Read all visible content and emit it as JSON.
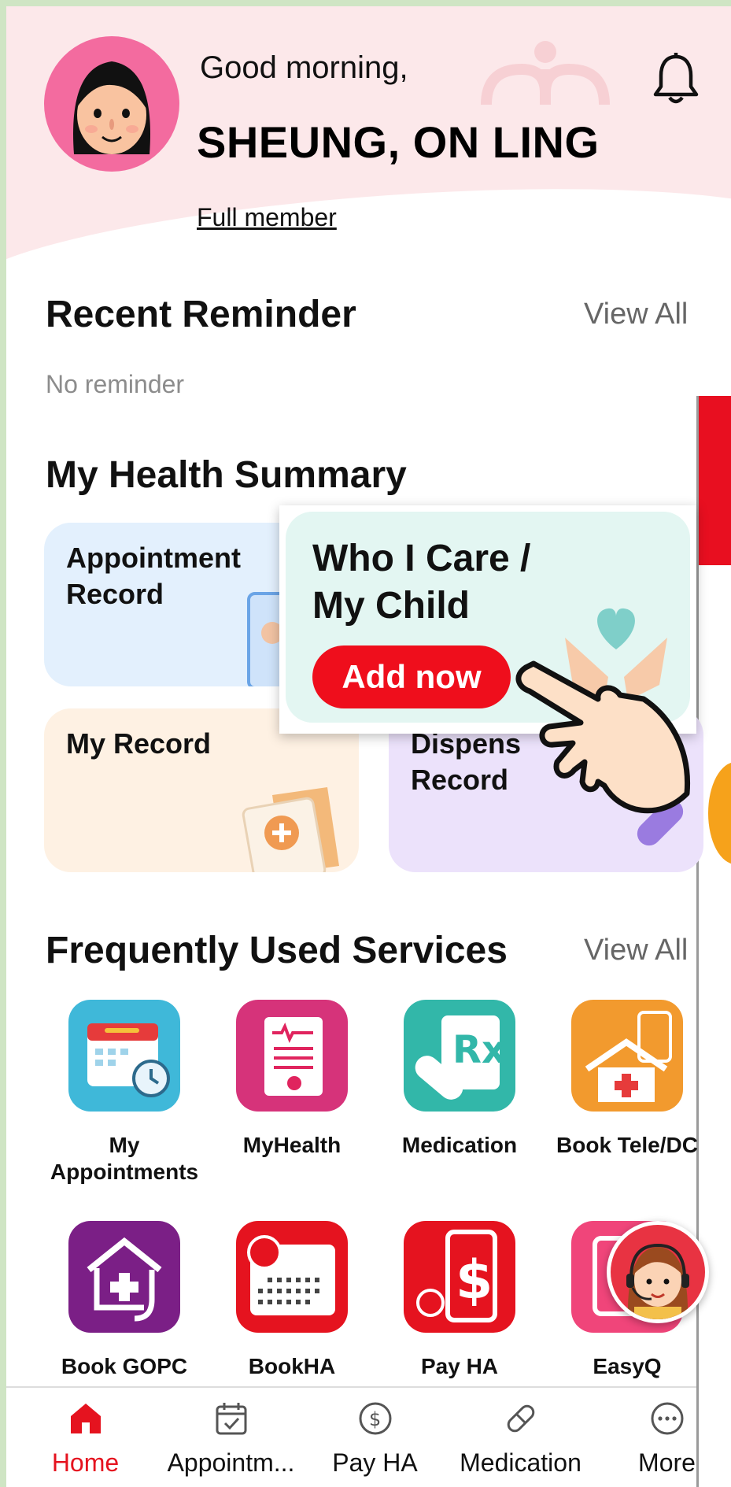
{
  "header": {
    "greeting": "Good morning,",
    "name": "SHEUNG, ON LING",
    "membership": "Full member"
  },
  "reminder": {
    "title": "Recent Reminder",
    "view_all": "View All",
    "empty_text": "No reminder"
  },
  "health_summary": {
    "title": "My Health Summary",
    "cards": [
      {
        "label": "Appointment Record"
      },
      {
        "label": "My Record"
      },
      {
        "label": "Dispens Record"
      }
    ]
  },
  "popup": {
    "title": "Who I Care / My Child",
    "button": "Add now"
  },
  "services": {
    "title": "Frequently Used Services",
    "view_all": "View All",
    "items": [
      {
        "label": "My Appointments",
        "icon": "calendar-clock-icon"
      },
      {
        "label": "MyHealth",
        "icon": "health-record-icon"
      },
      {
        "label": "Medication",
        "icon": "prescription-icon"
      },
      {
        "label": "Book Tele/DC",
        "icon": "telehealth-icon"
      },
      {
        "label": "Book GOPC",
        "icon": "gopc-icon"
      },
      {
        "label": "BookHA",
        "icon": "bookha-calendar-icon"
      },
      {
        "label": "Pay HA",
        "icon": "pay-ha-icon"
      },
      {
        "label": "EasyQ",
        "icon": "easyq-icon"
      }
    ]
  },
  "tabbar": {
    "items": [
      {
        "label": "Home",
        "icon": "home-icon",
        "active": true
      },
      {
        "label": "Appointm...",
        "icon": "calendar-check-icon",
        "active": false
      },
      {
        "label": "Pay HA",
        "icon": "dollar-icon",
        "active": false
      },
      {
        "label": "Medication",
        "icon": "pill-icon",
        "active": false
      },
      {
        "label": "More",
        "icon": "more-icon",
        "active": false
      }
    ]
  },
  "colors": {
    "accent": "#ef0e1c",
    "header_bg": "#fce8ea",
    "card_blue": "#e3f0fd",
    "card_peach": "#fef1e3",
    "card_purple": "#ece2fb",
    "popup_bg": "#e3f6f2"
  }
}
